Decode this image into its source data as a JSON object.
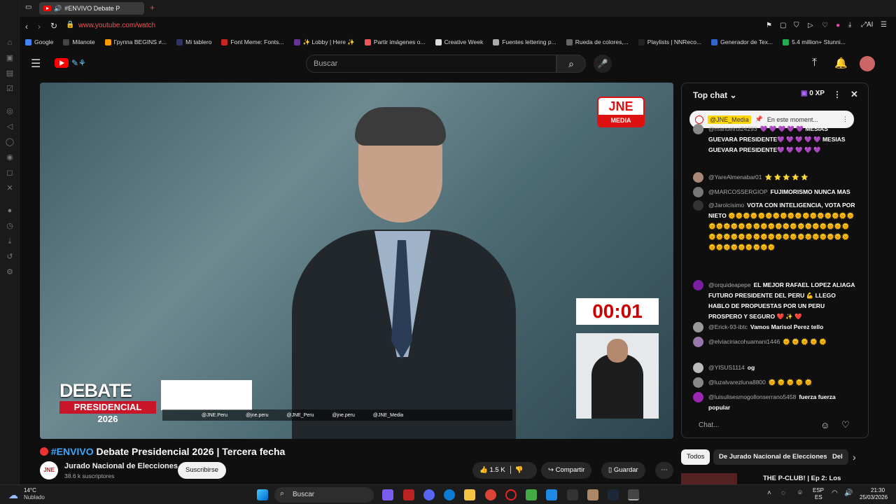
{
  "browser": {
    "tab_title": "#ENVIVO Debate P",
    "url": "www.youtube.com/watch",
    "bookmarks": [
      {
        "label": "Google",
        "color": "#4285f4"
      },
      {
        "label": "Milanote",
        "color": "#444"
      },
      {
        "label": "Группа BEGINS ≠...",
        "color": "#f90"
      },
      {
        "label": "Mi tablero",
        "color": "#336"
      },
      {
        "label": "Font Meme: Fonts...",
        "color": "#c22"
      },
      {
        "label": "✨ Lobby | Here ✨",
        "color": "#639"
      },
      {
        "label": "Partir imágenes o...",
        "color": "#e55"
      },
      {
        "label": "Creative Week",
        "color": "#ddd"
      },
      {
        "label": "Fuentes lettering p...",
        "color": "#aaa"
      },
      {
        "label": "Rueda de colores,...",
        "color": "#666"
      },
      {
        "label": "Playlists | NNReco...",
        "color": "#222"
      },
      {
        "label": "Generador de Tex...",
        "color": "#36c"
      },
      {
        "label": "5.4 million+ Stunni...",
        "color": "#2a5"
      }
    ]
  },
  "youtube": {
    "search_placeholder": "Buscar"
  },
  "video": {
    "jne_logo": "JNE",
    "jne_media": "MEDIA",
    "timer": "00:01",
    "debate_line1": "DEBATE",
    "debate_line2": "PRESIDENCIAL",
    "debate_line3": "2026",
    "socials": [
      "@JNE.Peru",
      "@jne.peru",
      "@JNE_Peru",
      "@jne.peru",
      "@JNE_Media"
    ]
  },
  "chat": {
    "title": "Top chat",
    "xp": "0 XP",
    "pinned_user": "@JNE_Media",
    "pinned_text": "En este moment...",
    "messages": [
      {
        "user": "@manuelrui24293",
        "text": "💜 💜 💜 💜 💜 MESIAS GUEVARA PRESIDENTE💜 💜 💜 💜 💜 MESIAS GUEVARA PRESIDENTE💜 💜 💜 💜 💜",
        "avatar": "#888"
      },
      {
        "user": "@YareAlmenabar01",
        "text": "⭐ ⭐ ⭐ ⭐ ⭐",
        "avatar": "#a87"
      },
      {
        "user": "@MARCOSSERGIOP",
        "text": "FUJIMORISMO NUNCA MAS",
        "avatar": "#777"
      },
      {
        "user": "@Jarolcisimo",
        "text": "VOTA CON INTELIGENCIA, VOTA POR NIETO 🌞🌞🌞🌞🌞🌞🌞🌞🌞🌞🌞🌞🌞🌞🌞🌞🌞🌞🌞🌞🌞🌞🌞🌞🌞🌞🌞🌞🌞🌞🌞🌞🌞🌞🌞🌞🌞🌞🌞🌞🌞🌞🌞🌞🌞🌞🌞🌞🌞🌞🌞🌞🌞🌞🌞🌞🌞🌞🌞🌞🌞🌞🌞🌞",
        "avatar": "#333"
      },
      {
        "user": "@orquideapepe",
        "text": "EL MEJOR RAFAEL LOPEZ ALIAGA FUTURO PRESIDENTE DEL PERU 💪 LLEGO HABLO DE PROPUESTAS POR UN PERU PROSPERO Y SEGURO ❤️ ✨ ❤️",
        "avatar": "#7b1fa2"
      },
      {
        "user": "@Erick-93-ibtc",
        "text": "Vamos Marisol Perez tello",
        "avatar": "#999"
      },
      {
        "user": "@elviaciriacohuamani1446",
        "text": "🌞 🌞 🌞 🌞 🌞",
        "avatar": "#97a"
      },
      {
        "user": "@YISUS1114",
        "text": "og",
        "avatar": "#bbb"
      },
      {
        "user": "@luzalvarezluna8800",
        "text": "🌞 🌞 🌞 🌞 🌞",
        "avatar": "#888"
      },
      {
        "user": "@luisulisesmogollonserrano5458",
        "text": "fuerza fuerza popular",
        "avatar": "#9c27b0"
      }
    ],
    "input_placeholder": "Chat..."
  },
  "below_video": {
    "live_tag": "#ENVIVO",
    "title": "Debate Presidencial 2026 | Tercera fecha",
    "channel": "Jurado Nacional de Elecciones",
    "channel_avatar": "JNE",
    "subscribers": "38.6 k suscriptores",
    "subscribe": "Suscribirse",
    "likes": "1.5 K",
    "share": "Compartir",
    "save": "Guardar"
  },
  "chips": [
    "Todos",
    "De Jurado Nacional de Elecciones",
    "Del"
  ],
  "recommendation_title": "THE P-CLUB! | Ep 2: Los",
  "taskbar": {
    "temp": "14°C",
    "weather": "Nublado",
    "search": "Buscar",
    "lang1": "ESP",
    "lang2": "ES",
    "time": "21:30",
    "date": "25/03/2026"
  }
}
